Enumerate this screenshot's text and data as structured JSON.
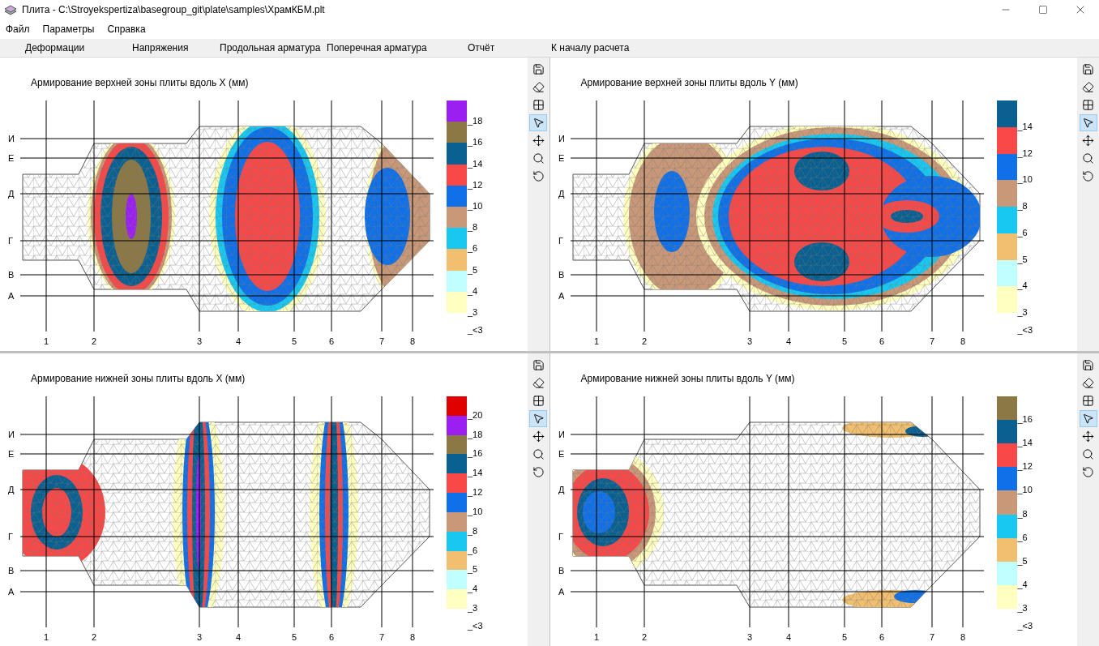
{
  "window": {
    "title": "Плита - C:\\Stroyekspertiza\\basegroup_git\\plate\\samples\\ХрамКБМ.plt"
  },
  "menu": [
    "Файл",
    "Параметры",
    "Справка"
  ],
  "tabs": [
    "Деформации",
    "Напряжения",
    "Продольная арматура",
    "Поперечная арматура",
    "Отчёт",
    "К началу расчета"
  ],
  "panels": [
    {
      "title": "Армирование верхней зоны плиты вдоль X (мм)",
      "y_labels": [
        "И",
        "Е",
        "Д",
        "Г",
        "В",
        "А"
      ],
      "x_labels": [
        "1",
        "2",
        "3",
        "4",
        "5",
        "6",
        "7",
        "8"
      ],
      "legend": [
        {
          "color": "#9b1ff0",
          "label": "_18"
        },
        {
          "color": "#8b7845",
          "label": "_16"
        },
        {
          "color": "#0a6090",
          "label": "_14"
        },
        {
          "color": "#f84848",
          "label": "_12"
        },
        {
          "color": "#1070e8",
          "label": "_10"
        },
        {
          "color": "#c89878",
          "label": "_8"
        },
        {
          "color": "#18c8f0",
          "label": "_6"
        },
        {
          "color": "#f0c070",
          "label": "_5"
        },
        {
          "color": "#c0ffff",
          "label": "_4"
        },
        {
          "color": "#ffffc0",
          "label": "_3"
        }
      ],
      "below": "_<3",
      "tools": [
        {
          "kind": "save",
          "selected": false
        },
        {
          "kind": "eraser",
          "selected": false
        },
        {
          "kind": "grid",
          "selected": false
        },
        {
          "kind": "pointer",
          "selected": true
        },
        {
          "kind": "move",
          "selected": false
        },
        {
          "kind": "zoom",
          "selected": false
        },
        {
          "kind": "rotate",
          "selected": false
        }
      ]
    },
    {
      "title": "Армирование верхней зоны плиты вдоль Y (мм)",
      "y_labels": [
        "И",
        "Е",
        "Д",
        "Г",
        "В",
        "А"
      ],
      "x_labels": [
        "1",
        "2",
        "3",
        "4",
        "5",
        "6",
        "7",
        "8"
      ],
      "legend": [
        {
          "color": "#0a6090",
          "label": "_14"
        },
        {
          "color": "#f84848",
          "label": "_12"
        },
        {
          "color": "#1070e8",
          "label": "_10"
        },
        {
          "color": "#c89878",
          "label": "_8"
        },
        {
          "color": "#18c8f0",
          "label": "_6"
        },
        {
          "color": "#f0c070",
          "label": "_5"
        },
        {
          "color": "#c0ffff",
          "label": "_4"
        },
        {
          "color": "#ffffc0",
          "label": "_3"
        }
      ],
      "below": "_<3",
      "tools": [
        {
          "kind": "save",
          "selected": false
        },
        {
          "kind": "eraser",
          "selected": false
        },
        {
          "kind": "grid",
          "selected": false
        },
        {
          "kind": "pointer",
          "selected": true
        },
        {
          "kind": "move",
          "selected": false
        },
        {
          "kind": "zoom",
          "selected": false
        },
        {
          "kind": "rotate",
          "selected": false
        }
      ]
    },
    {
      "title": "Армирование нижней зоны плиты вдоль X (мм)",
      "y_labels": [
        "И",
        "Е",
        "Д",
        "Г",
        "В",
        "А"
      ],
      "x_labels": [
        "1",
        "2",
        "3",
        "4",
        "5",
        "6",
        "7",
        "8"
      ],
      "legend": [
        {
          "color": "#e00000",
          "label": "_20"
        },
        {
          "color": "#9b1ff0",
          "label": "_18"
        },
        {
          "color": "#8b7845",
          "label": "_16"
        },
        {
          "color": "#0a6090",
          "label": "_14"
        },
        {
          "color": "#f84848",
          "label": "_12"
        },
        {
          "color": "#1070e8",
          "label": "_10"
        },
        {
          "color": "#c89878",
          "label": "_8"
        },
        {
          "color": "#18c8f0",
          "label": "_6"
        },
        {
          "color": "#f0c070",
          "label": "_5"
        },
        {
          "color": "#c0ffff",
          "label": "_4"
        },
        {
          "color": "#ffffc0",
          "label": "_3"
        }
      ],
      "below": "_<3",
      "tools": [
        {
          "kind": "save",
          "selected": false
        },
        {
          "kind": "eraser",
          "selected": false
        },
        {
          "kind": "grid",
          "selected": false
        },
        {
          "kind": "pointer",
          "selected": true
        },
        {
          "kind": "move",
          "selected": false
        },
        {
          "kind": "zoom",
          "selected": false
        },
        {
          "kind": "rotate",
          "selected": false
        }
      ]
    },
    {
      "title": "Армирование нижней зоны плиты вдоль Y (мм)",
      "y_labels": [
        "И",
        "Е",
        "Д",
        "Г",
        "В",
        "А"
      ],
      "x_labels": [
        "1",
        "2",
        "3",
        "4",
        "5",
        "6",
        "7",
        "8"
      ],
      "legend": [
        {
          "color": "#8b7845",
          "label": "_16"
        },
        {
          "color": "#0a6090",
          "label": "_14"
        },
        {
          "color": "#f84848",
          "label": "_12"
        },
        {
          "color": "#1070e8",
          "label": "_10"
        },
        {
          "color": "#c89878",
          "label": "_8"
        },
        {
          "color": "#18c8f0",
          "label": "_6"
        },
        {
          "color": "#f0c070",
          "label": "_5"
        },
        {
          "color": "#c0ffff",
          "label": "_4"
        },
        {
          "color": "#ffffc0",
          "label": "_3"
        }
      ],
      "below": "_<3",
      "tools": [
        {
          "kind": "save",
          "selected": false
        },
        {
          "kind": "eraser",
          "selected": false
        },
        {
          "kind": "grid",
          "selected": false
        },
        {
          "kind": "pointer",
          "selected": true
        },
        {
          "kind": "move",
          "selected": false
        },
        {
          "kind": "zoom",
          "selected": false
        },
        {
          "kind": "rotate",
          "selected": false
        }
      ]
    }
  ]
}
